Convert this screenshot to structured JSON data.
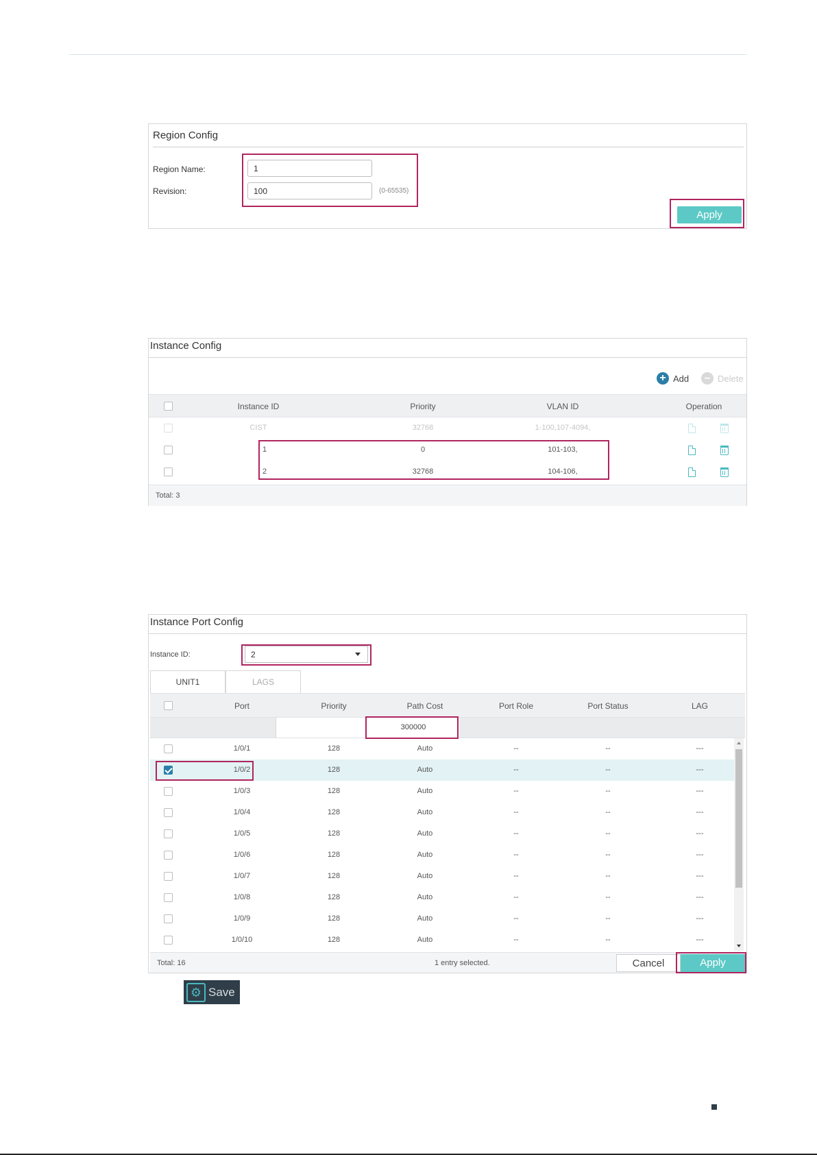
{
  "region": {
    "title": "Region Config",
    "region_name_label": "Region Name:",
    "region_name_value": "1",
    "revision_label": "Revision:",
    "revision_value": "100",
    "revision_hint": "(0-65535)",
    "apply_label": "Apply"
  },
  "instance": {
    "title": "Instance Config",
    "add_label": "Add",
    "delete_label": "Delete",
    "headers": [
      "Instance ID",
      "Priority",
      "VLAN ID",
      "Operation"
    ],
    "rows": [
      {
        "id": "CIST",
        "priority": "32768",
        "vlan": "1-100,107-4094,"
      },
      {
        "id": "1",
        "priority": "0",
        "vlan": "101-103,"
      },
      {
        "id": "2",
        "priority": "32768",
        "vlan": "104-106,"
      }
    ],
    "total": "Total: 3"
  },
  "port_config": {
    "title": "Instance Port Config",
    "instance_id_label": "Instance ID:",
    "instance_id_value": "2",
    "tabs": [
      "UNIT1",
      "LAGS"
    ],
    "headers": [
      "Port",
      "Priority",
      "Path Cost",
      "Port Role",
      "Port Status",
      "LAG"
    ],
    "path_cost_input": "300000",
    "rows": [
      {
        "port": "1/0/1",
        "priority": "128",
        "cost": "Auto",
        "role": "--",
        "status": "--",
        "lag": "---"
      },
      {
        "port": "1/0/2",
        "priority": "128",
        "cost": "Auto",
        "role": "--",
        "status": "--",
        "lag": "---"
      },
      {
        "port": "1/0/3",
        "priority": "128",
        "cost": "Auto",
        "role": "--",
        "status": "--",
        "lag": "---"
      },
      {
        "port": "1/0/4",
        "priority": "128",
        "cost": "Auto",
        "role": "--",
        "status": "--",
        "lag": "---"
      },
      {
        "port": "1/0/5",
        "priority": "128",
        "cost": "Auto",
        "role": "--",
        "status": "--",
        "lag": "---"
      },
      {
        "port": "1/0/6",
        "priority": "128",
        "cost": "Auto",
        "role": "--",
        "status": "--",
        "lag": "---"
      },
      {
        "port": "1/0/7",
        "priority": "128",
        "cost": "Auto",
        "role": "--",
        "status": "--",
        "lag": "---"
      },
      {
        "port": "1/0/8",
        "priority": "128",
        "cost": "Auto",
        "role": "--",
        "status": "--",
        "lag": "---"
      },
      {
        "port": "1/0/9",
        "priority": "128",
        "cost": "Auto",
        "role": "--",
        "status": "--",
        "lag": "---"
      },
      {
        "port": "1/0/10",
        "priority": "128",
        "cost": "Auto",
        "role": "--",
        "status": "--",
        "lag": "---"
      }
    ],
    "total": "Total: 16",
    "selected": "1 entry selected.",
    "cancel_label": "Cancel",
    "apply_label": "Apply"
  },
  "save": {
    "label": "Save"
  },
  "colors": {
    "accent": "#5cc9c6",
    "highlight": "#b0245e",
    "icon": "#49b8c0"
  }
}
